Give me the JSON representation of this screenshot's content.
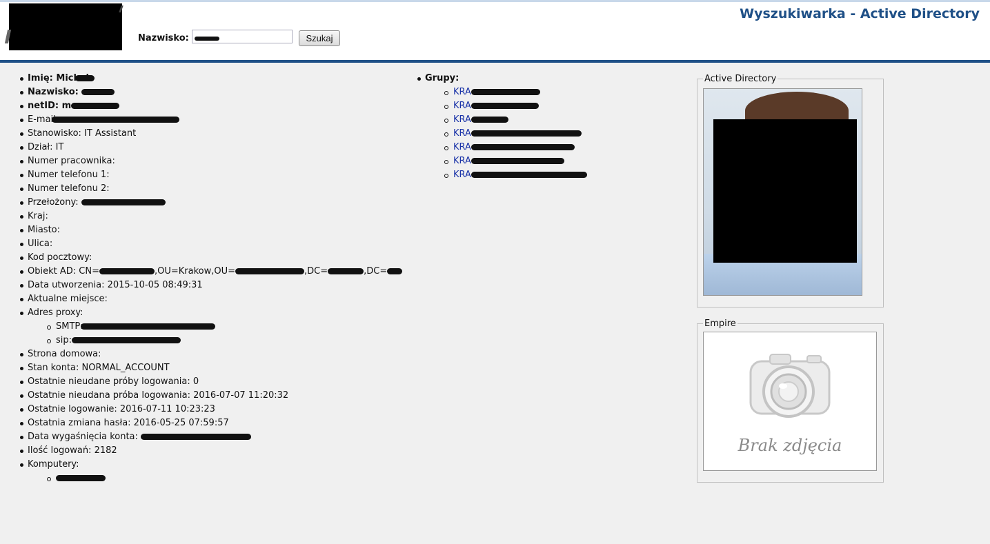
{
  "header": {
    "app_title": "Wyszukiwarka - Active Directory",
    "search_label": "Nazwisko:",
    "search_button": "Szukaj"
  },
  "details": [
    {
      "label": "Imię: Michal",
      "bold": true
    },
    {
      "label": "Nazwisko:",
      "bold": true
    },
    {
      "label": "netID: m",
      "bold": true
    },
    {
      "label": "E-mail:"
    },
    {
      "label": "Stanowisko: IT Assistant"
    },
    {
      "label": "Dział: IT"
    },
    {
      "label": "Numer pracownika:"
    },
    {
      "label": "Numer telefonu 1:"
    },
    {
      "label": "Numer telefonu 2:"
    },
    {
      "label": "Przełożony:"
    },
    {
      "label": "Kraj:"
    },
    {
      "label": "Miasto:"
    },
    {
      "label": "Ulica:"
    },
    {
      "label": "Kod pocztowy:"
    },
    {
      "label": "Obiekt AD: CN=",
      "ad_parts": [
        ",OU=Krakow,OU=",
        ",DC=",
        ",DC="
      ]
    },
    {
      "label": "Data utworzenia: 2015-10-05 08:49:31"
    },
    {
      "label": "Aktualne miejsce:"
    },
    {
      "label": "Adres proxy:",
      "children": [
        "SMTP:",
        "sip:"
      ]
    },
    {
      "label": "Strona domowa:"
    },
    {
      "label": "Stan konta: NORMAL_ACCOUNT"
    },
    {
      "label": "Ostatnie nieudane próby logowania: 0"
    },
    {
      "label": "Ostatnie nieudana próba logowania: 2016-07-07 11:20:32"
    },
    {
      "label": "Ostatnie logowanie: 2016-07-11 10:23:23"
    },
    {
      "label": "Ostatnia zmiana hasła: 2016-05-25 07:59:57"
    },
    {
      "label": "Data wygaśnięcia konta:"
    },
    {
      "label": "Ilość logowań: 2182"
    },
    {
      "label": "Komputery:",
      "children": [
        ""
      ]
    }
  ],
  "groups": {
    "label": "Grupy:",
    "items": [
      "KRA-",
      "KRA-",
      "KRA-",
      "KRA-",
      "KRA-",
      "KRA-",
      "KRA-"
    ]
  },
  "panels": {
    "ad_legend": "Active Directory",
    "empire_legend": "Empire",
    "no_photo_text": "Brak zdjęcia"
  },
  "colors": {
    "accent": "#1f5087",
    "link": "#1a33a8",
    "background": "#f0f0f0"
  }
}
